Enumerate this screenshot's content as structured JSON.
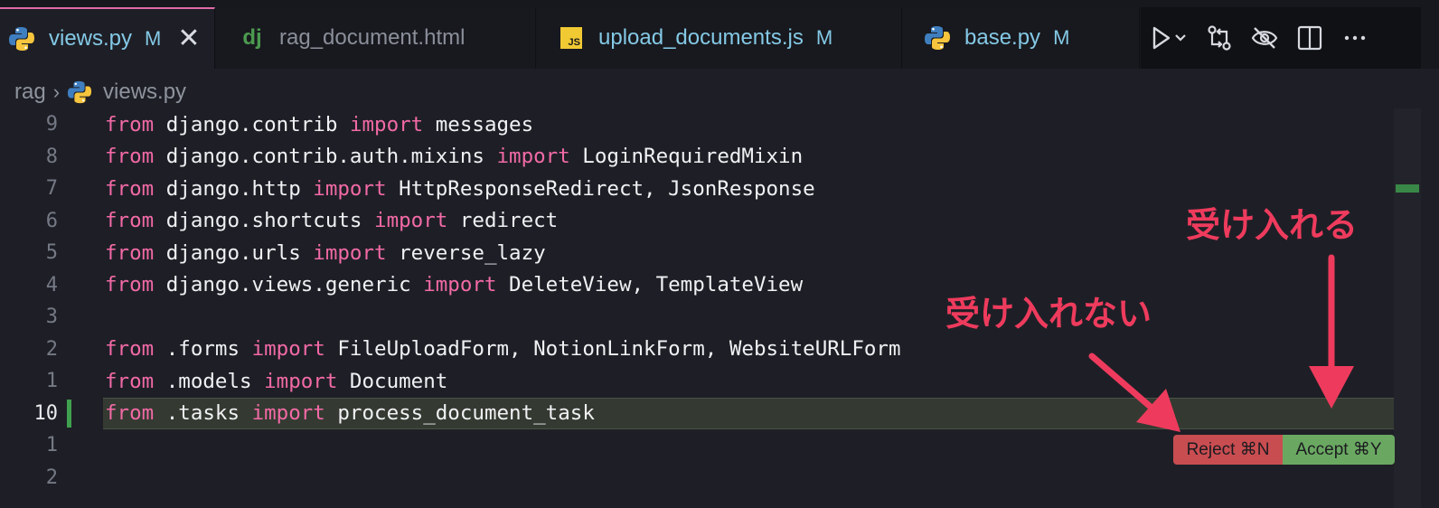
{
  "tabs": [
    {
      "label": "views.py",
      "modified": "M",
      "icon": "python-icon",
      "active": true,
      "close": "✕"
    },
    {
      "label": "rag_document.html",
      "modified": "",
      "icon": "django-icon",
      "active": false,
      "icon_text": "dj"
    },
    {
      "label": "upload_documents.js",
      "modified": "M",
      "icon": "javascript-icon",
      "active": false,
      "icon_text": "JS"
    },
    {
      "label": "base.py",
      "modified": "M",
      "icon": "python-icon",
      "active": false
    }
  ],
  "toolbar": {
    "run": "run-icon",
    "run_menu": "chevron-down-icon",
    "compare": "compare-changes-icon",
    "hide": "eye-off-icon",
    "split": "split-editor-icon",
    "more": "more-actions-icon"
  },
  "breadcrumb": {
    "folder": "rag",
    "file": "views.py"
  },
  "editor": {
    "lines": [
      {
        "num": "9",
        "from": "from",
        "module": " django.contrib ",
        "imp": "import",
        "names": " messages"
      },
      {
        "num": "8",
        "from": "from",
        "module": " django.contrib.auth.mixins ",
        "imp": "import",
        "names": " LoginRequiredMixin"
      },
      {
        "num": "7",
        "from": "from",
        "module": " django.http ",
        "imp": "import",
        "names": " HttpResponseRedirect, JsonResponse"
      },
      {
        "num": "6",
        "from": "from",
        "module": " django.shortcuts ",
        "imp": "import",
        "names": " redirect"
      },
      {
        "num": "5",
        "from": "from",
        "module": " django.urls ",
        "imp": "import",
        "names": " reverse_lazy"
      },
      {
        "num": "4",
        "from": "from",
        "module": " django.views.generic ",
        "imp": "import",
        "names": " DeleteView, TemplateView"
      },
      {
        "num": "3",
        "from": "",
        "module": "",
        "imp": "",
        "names": ""
      },
      {
        "num": "2",
        "from": "from",
        "module": " .forms ",
        "imp": "import",
        "names": " FileUploadForm, NotionLinkForm, WebsiteURLForm"
      },
      {
        "num": "1",
        "from": "from",
        "module": " .models ",
        "imp": "import",
        "names": " Document"
      },
      {
        "num": "10",
        "from": "from",
        "module": " .tasks ",
        "imp": "import",
        "names": " process_document_task"
      },
      {
        "num": "1",
        "from": "",
        "module": "",
        "imp": "",
        "names": ""
      },
      {
        "num": "2",
        "from": "",
        "module": "",
        "imp": "",
        "names": ""
      }
    ]
  },
  "diff_actions": {
    "reject_label": "Reject ⌘N",
    "accept_label": "Accept ⌘Y"
  },
  "annotations": {
    "accept_note": "受け入れる",
    "reject_note": "受け入れない"
  },
  "colors": {
    "keyword": "#f26aa6",
    "accent_arrow": "#ee3b5d",
    "added_gutter": "#3fa14f",
    "reject_bg": "#c84d51",
    "accept_bg": "#6aa862"
  }
}
